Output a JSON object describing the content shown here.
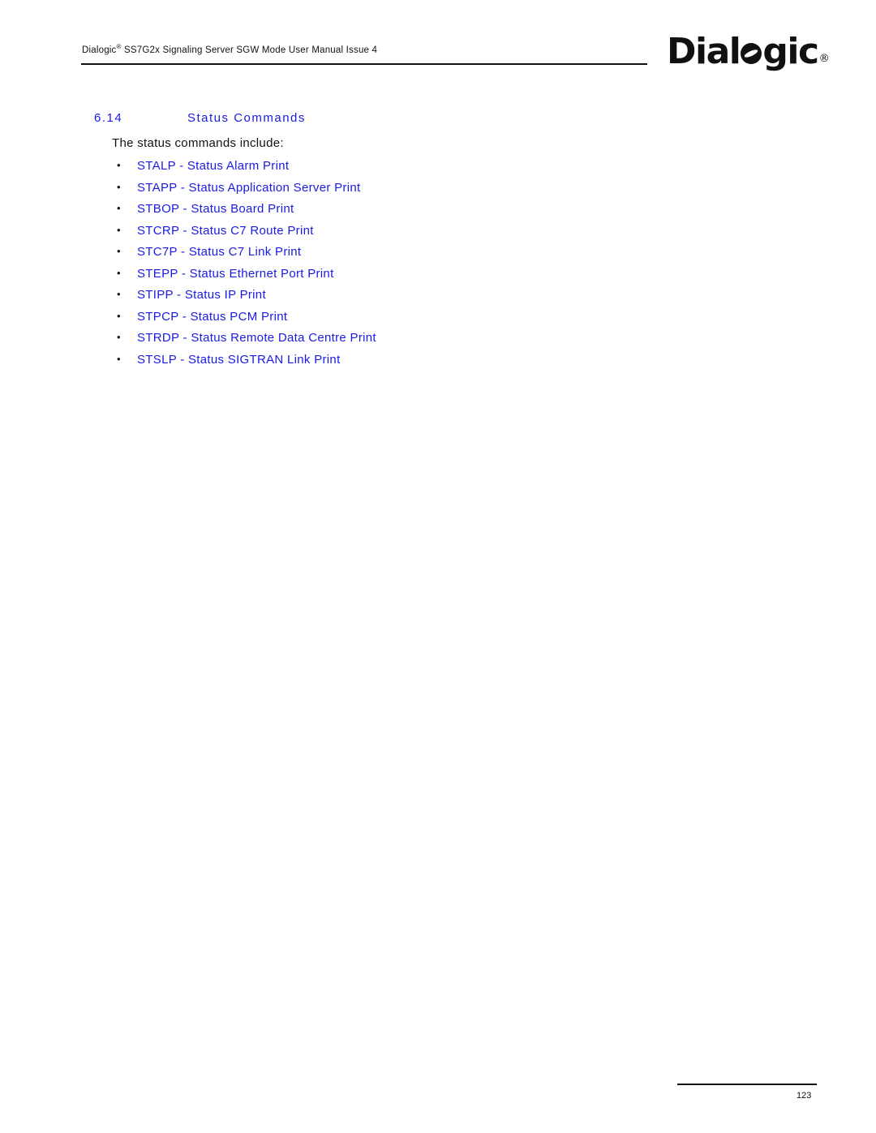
{
  "header": {
    "brand": "Dialogic",
    "registered_mark": "®",
    "title_rest": "SS7G2x Signaling Server SGW Mode User Manual  Issue 4"
  },
  "logo": {
    "text_before": "Dial",
    "text_after": "gic",
    "registered_mark": "®"
  },
  "section": {
    "number": "6.14",
    "title": "Status Commands",
    "intro": "The status commands include:",
    "items": [
      {
        "code": "STALP",
        "label": "Status Alarm Print"
      },
      {
        "code": "STAPP",
        "label": "Status Application Server Print"
      },
      {
        "code": "STBOP",
        "label": "Status Board Print"
      },
      {
        "code": "STCRP",
        "label": "Status C7 Route Print"
      },
      {
        "code": "STC7P",
        "label": "Status C7 Link Print"
      },
      {
        "code": "STEPP",
        "label": "Status Ethernet Port Print"
      },
      {
        "code": "STIPP",
        "label": "Status IP Print"
      },
      {
        "code": "STPCP",
        "label": "Status PCM Print"
      },
      {
        "code": "STRDP",
        "label": "Status Remote Data Centre Print"
      },
      {
        "code": "STSLP",
        "label": "Status SIGTRAN Link Print"
      }
    ],
    "separator": " - ",
    "bullet": "•"
  },
  "footer": {
    "page_number": "123"
  }
}
